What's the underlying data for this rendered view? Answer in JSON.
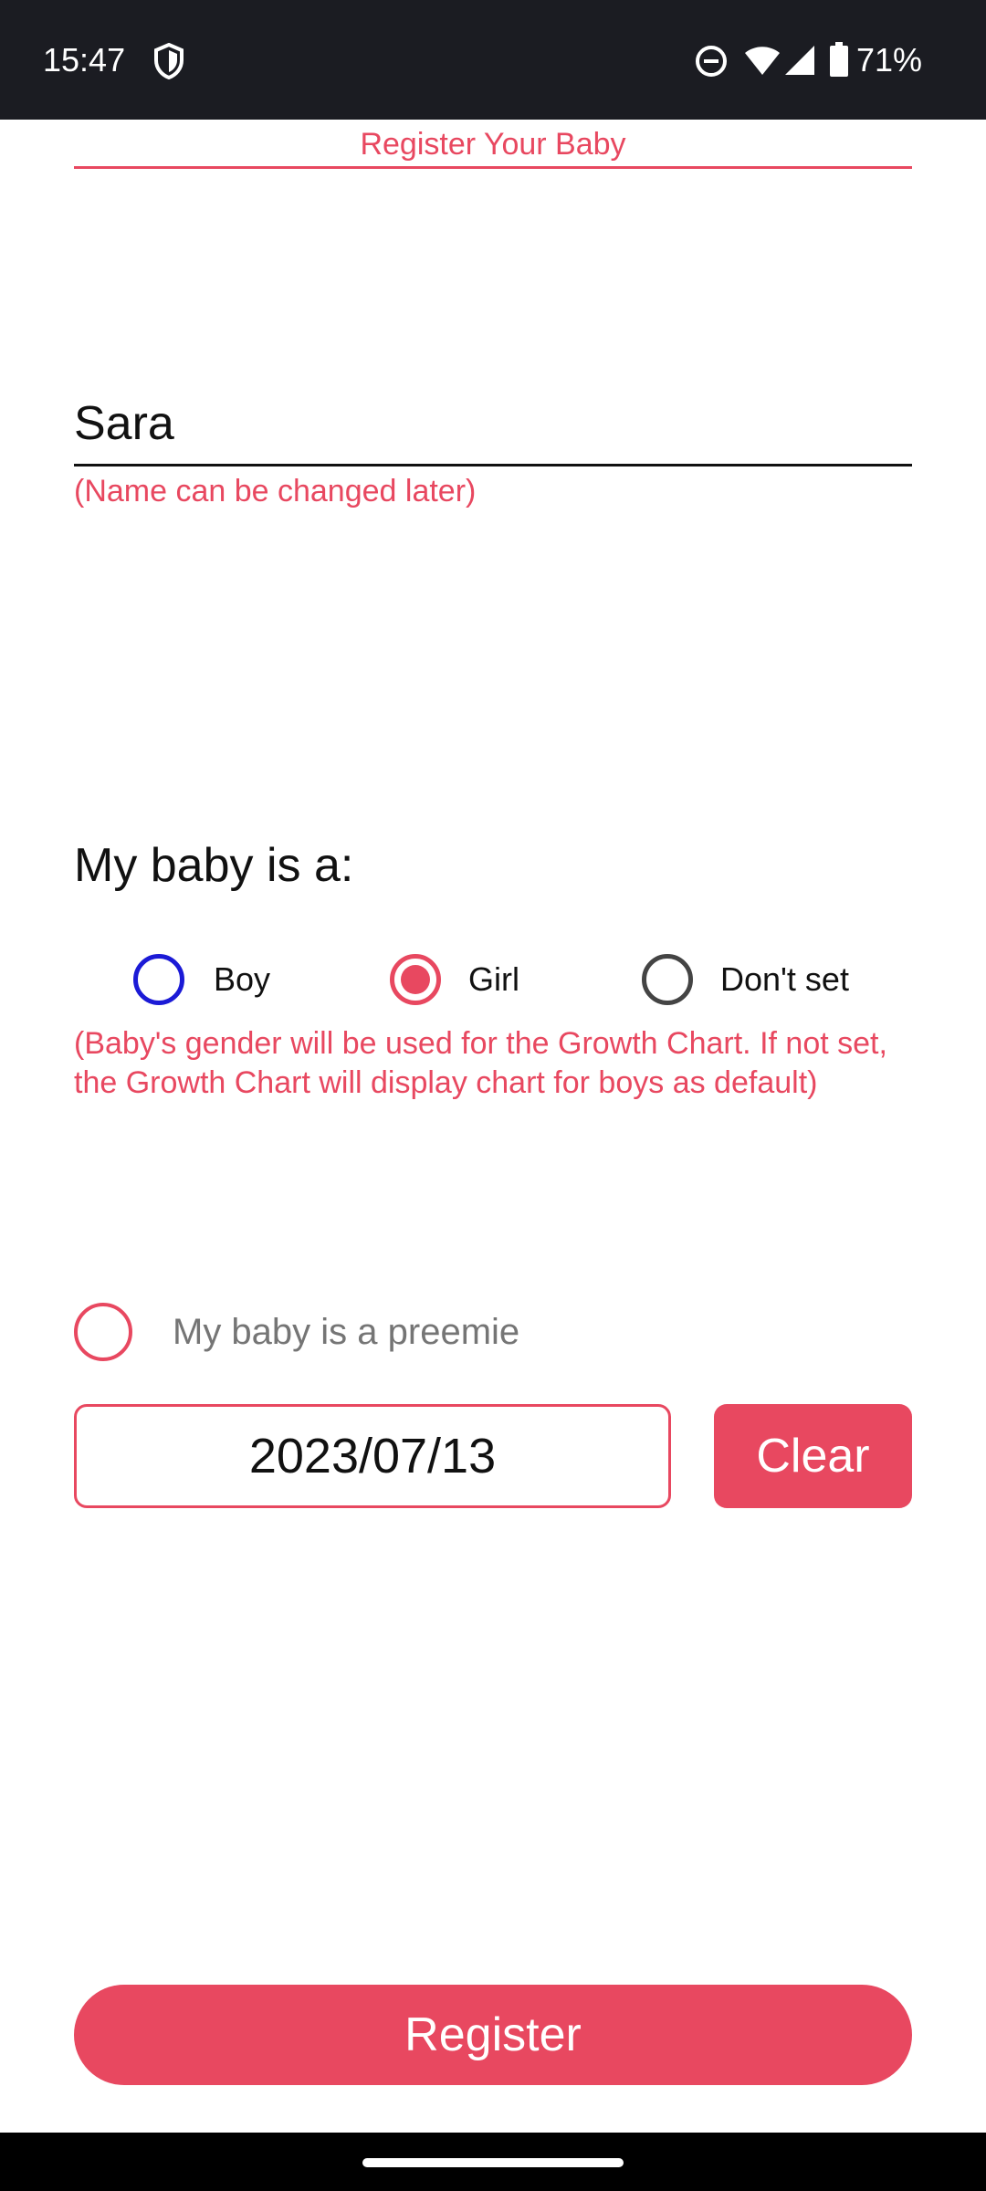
{
  "status_bar": {
    "time": "15:47",
    "battery": "71%",
    "icons": [
      "shield-icon",
      "do-not-disturb-icon",
      "wifi-icon",
      "signal-icon",
      "battery-icon"
    ]
  },
  "header": {
    "title": "Register Your Baby"
  },
  "name_field": {
    "value": "Sara",
    "hint": "(Name can be changed later)"
  },
  "gender": {
    "heading": "My baby is a:",
    "options": [
      {
        "label": "Boy",
        "selected": false
      },
      {
        "label": "Girl",
        "selected": true
      },
      {
        "label": "Don't set",
        "selected": false
      }
    ],
    "note": "(Baby's gender will be used for the Growth Chart. If not set, the Growth Chart will display chart for boys as default)"
  },
  "preemie": {
    "label": "My baby is a preemie",
    "checked": false
  },
  "due_date": {
    "value": "2023/07/13",
    "clear_label": "Clear"
  },
  "register_label": "Register",
  "colors": {
    "accent": "#e84860",
    "boy_radio": "#1b1ad6",
    "status_bar_bg": "#1b1c22"
  }
}
